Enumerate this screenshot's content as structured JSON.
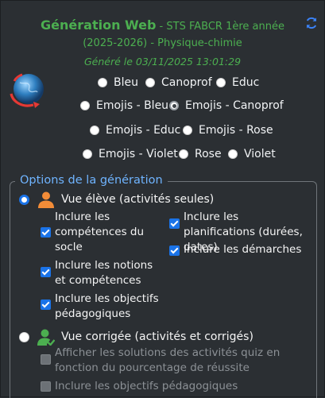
{
  "header": {
    "title_strong": "Génération Web",
    "title_rest": " - STS FABCR 1ère année",
    "subtitle": "(2025-2026) - Physique-chimie",
    "generated": "Généré le 03/11/2025 13:01:29",
    "refresh_icon": "refresh-icon",
    "globe_icon": "globe-icon"
  },
  "themes": [
    {
      "label": "Bleu",
      "selected": false
    },
    {
      "label": "Canoprof",
      "selected": false
    },
    {
      "label": "Educ",
      "selected": false
    },
    {
      "label": "Emojis - Bleu",
      "selected": false
    },
    {
      "label": "Emojis - Canoprof",
      "selected": true
    },
    {
      "label": "Emojis - Educ",
      "selected": false
    },
    {
      "label": "Emojis - Rose",
      "selected": false
    },
    {
      "label": "Emojis - Violet",
      "selected": false
    },
    {
      "label": "Rose",
      "selected": false
    },
    {
      "label": "Violet",
      "selected": false
    }
  ],
  "options": {
    "legend": "Options de la génération",
    "student": {
      "label": "Vue élève (activités seules)",
      "selected": true,
      "icon_color": "#f28c38",
      "checks": {
        "socle": "Inclure les compétences du socle",
        "notions": "Inclure les notions et compétences",
        "objectifs": "Inclure les objectifs pédagogiques",
        "planifications": "Inclure les planifications (durées, dates)",
        "demarches": "Inclure les démarches"
      }
    },
    "corrected": {
      "label": "Vue corrigée (activités et corrigés)",
      "selected": false,
      "icon_color": "#4caf50",
      "checks": {
        "solutions": "Afficher les solutions des activités quiz en fonction du pourcentage de réussite",
        "objectifs": "Inclure les objectifs pédagogiques"
      }
    }
  },
  "colors": {
    "accent": "#1a73e8",
    "title_green": "#4caf50",
    "legend_blue": "#6fb4ff",
    "background": "#2b2f33"
  }
}
